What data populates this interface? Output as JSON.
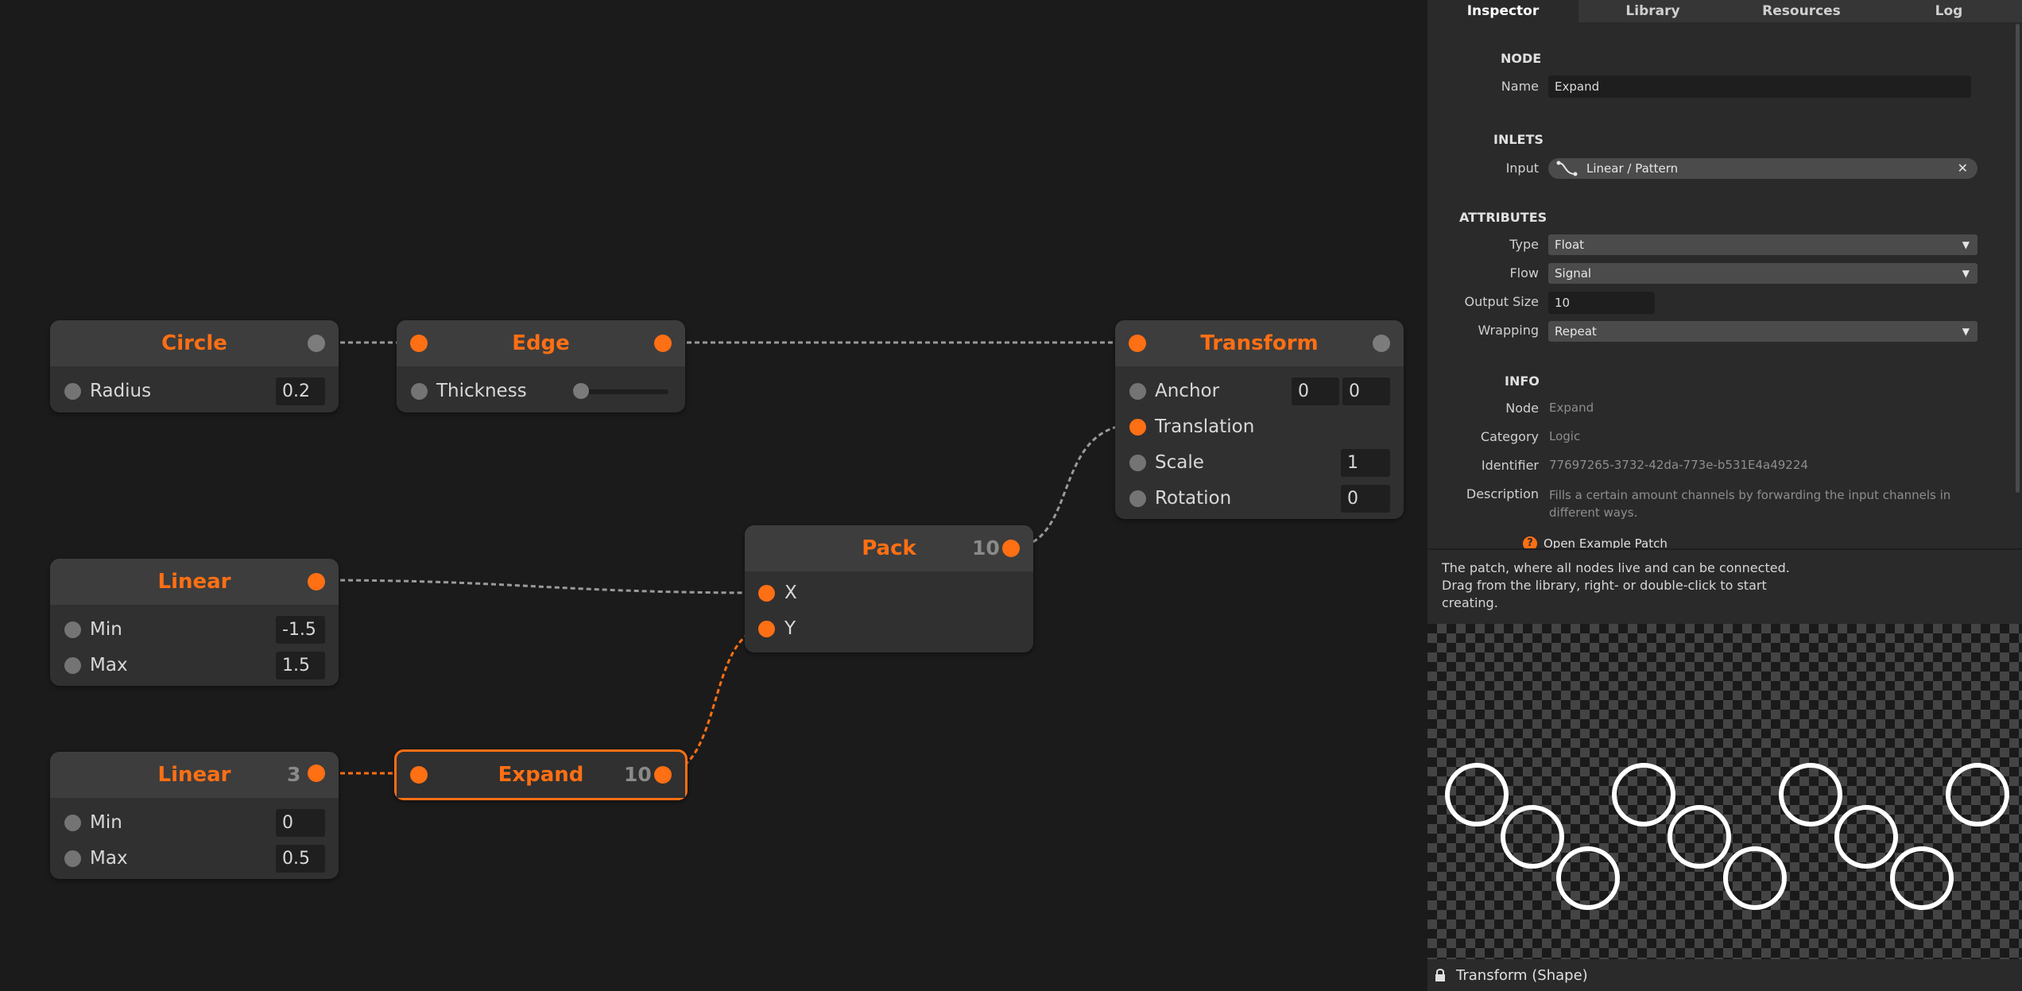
{
  "nodes": {
    "circle": {
      "title": "Circle",
      "radius_label": "Radius",
      "radius_value": "0.2"
    },
    "edge": {
      "title": "Edge",
      "thickness_label": "Thickness"
    },
    "transform": {
      "title": "Transform",
      "anchor_label": "Anchor",
      "anchor_x": "0",
      "anchor_y": "0",
      "translation_label": "Translation",
      "scale_label": "Scale",
      "scale_value": "1",
      "rotation_label": "Rotation",
      "rotation_value": "0"
    },
    "linear1": {
      "title": "Linear",
      "min_label": "Min",
      "min_value": "-1.5",
      "max_label": "Max",
      "max_value": "1.5"
    },
    "pack": {
      "title": "Pack",
      "count": "10",
      "x_label": "X",
      "y_label": "Y"
    },
    "linear2": {
      "title": "Linear",
      "count": "3",
      "min_label": "Min",
      "min_value": "0",
      "max_label": "Max",
      "max_value": "0.5"
    },
    "expand": {
      "title": "Expand",
      "count": "10"
    }
  },
  "panel": {
    "tabs": [
      "Inspector",
      "Library",
      "Resources",
      "Log"
    ],
    "active_tab": "Inspector",
    "node_section": "NODE",
    "name_label": "Name",
    "name_value": "Expand",
    "inlets_section": "INLETS",
    "input_label": "Input",
    "input_value": "Linear / Pattern",
    "attributes_section": "ATTRIBUTES",
    "type_label": "Type",
    "type_value": "Float",
    "flow_label": "Flow",
    "flow_value": "Signal",
    "output_size_label": "Output Size",
    "output_size_value": "10",
    "wrapping_label": "Wrapping",
    "wrapping_value": "Repeat",
    "info_section": "INFO",
    "info_node_label": "Node",
    "info_node_value": "Expand",
    "category_label": "Category",
    "category_value": "Logic",
    "identifier_label": "Identifier",
    "identifier_value": "77697265-3732-42da-773e-b531E4a49224",
    "description_label": "Description",
    "description_value": "Fills a certain amount channels by forwarding the input channels in different ways.",
    "open_example": "Open Example Patch",
    "hint": "The patch, where all nodes live and can be connected. Drag from the library, right- or double-click to start creating.",
    "preview_label": "Transform (Shape)"
  },
  "colors": {
    "accent": "#ff6f14",
    "background": "#1b1b1b",
    "node": "#303030",
    "node_header": "#3d3d3d",
    "panel": "#2a2a2a"
  }
}
